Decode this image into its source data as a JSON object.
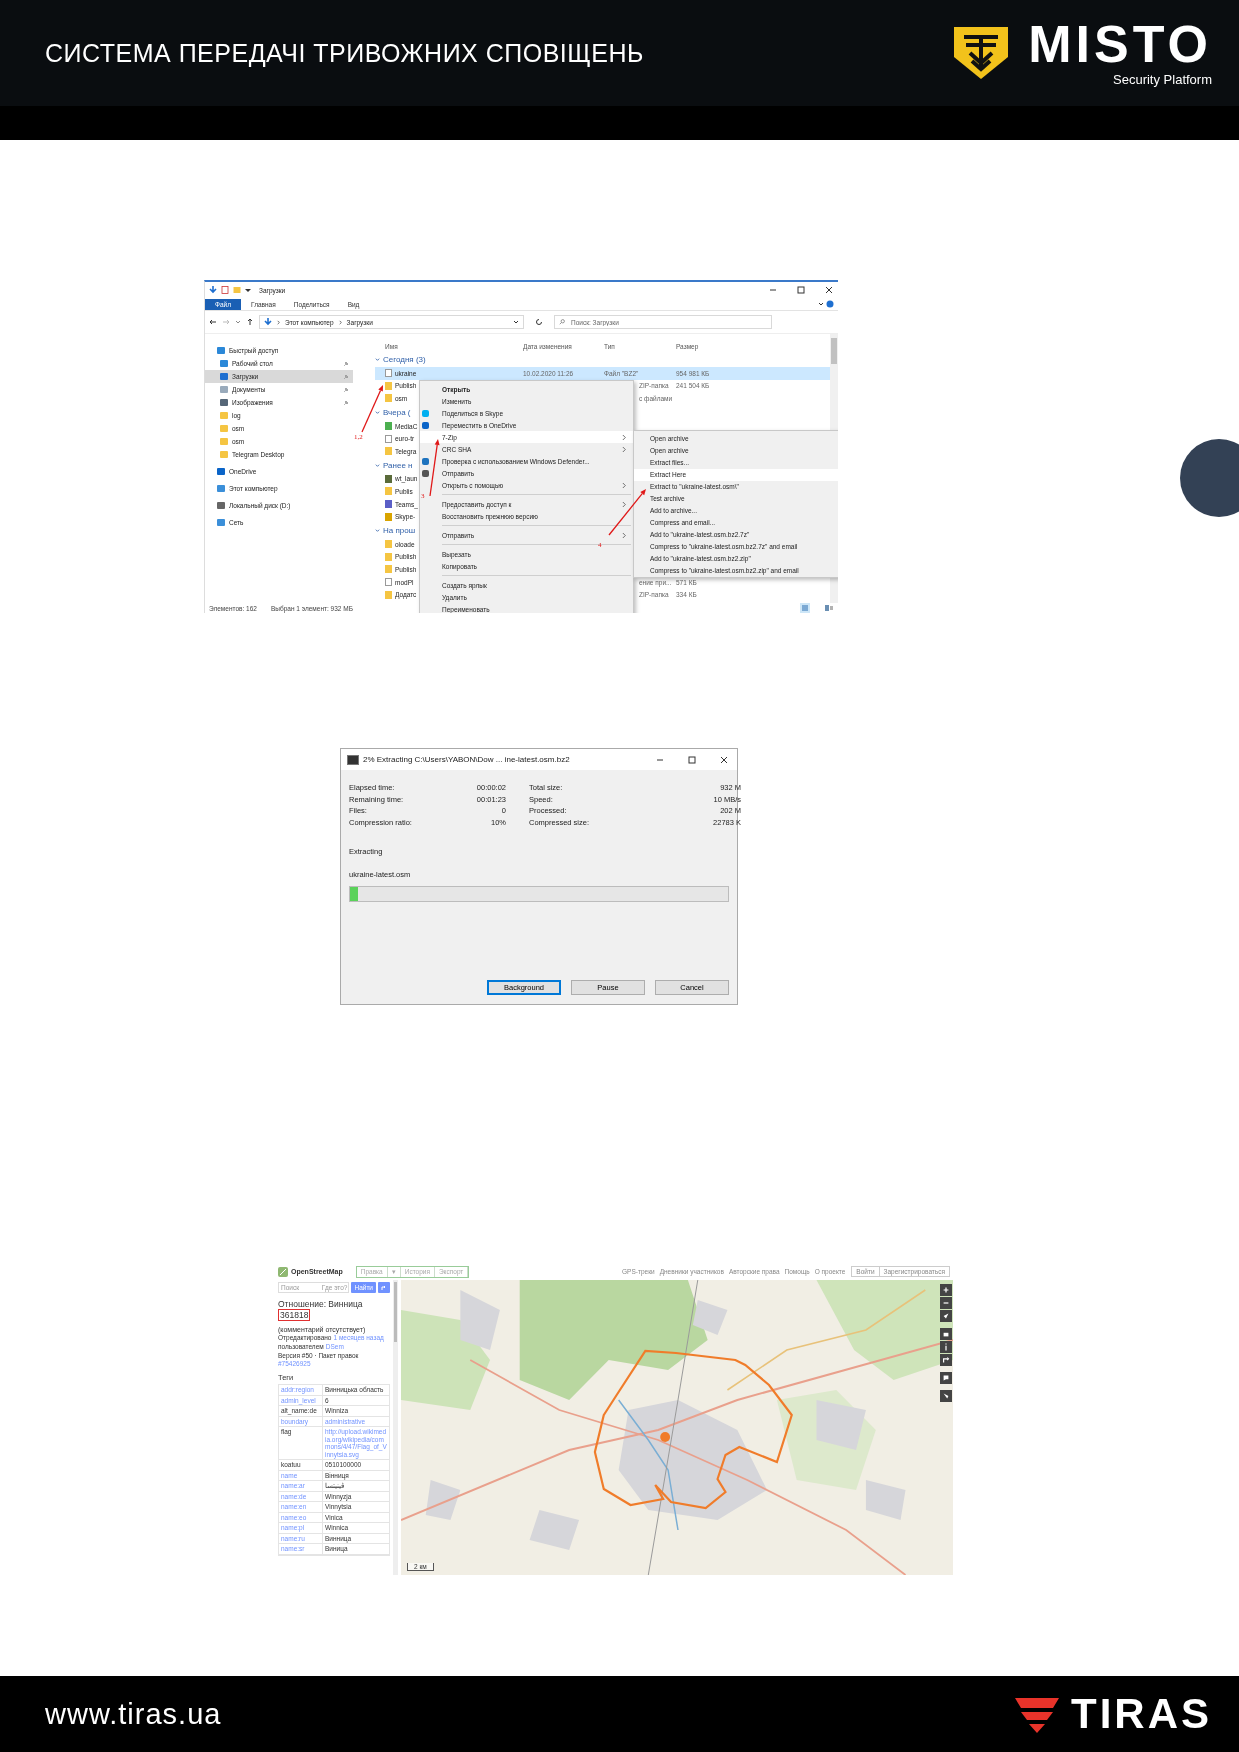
{
  "header": {
    "title": "СИСТЕМА ПЕРЕДАЧІ ТРИВОЖНИХ СПОВІЩЕНЬ",
    "logo": {
      "name": "MISTO",
      "tagline": "Security Platform"
    }
  },
  "explorer": {
    "title": "Загрузки",
    "ribbon_tabs": [
      {
        "label": "Файл",
        "selected": true
      },
      {
        "label": "Главная",
        "selected": false
      },
      {
        "label": "Поделиться",
        "selected": false
      },
      {
        "label": "Вид",
        "selected": false
      }
    ],
    "path": [
      "Этот компьютер",
      "Загрузки"
    ],
    "search": {
      "placeholder": "Поиск: Загрузки"
    },
    "nav": [
      {
        "label": "Быстрый доступ",
        "kind": "star",
        "selected": false,
        "children": [
          {
            "label": "Рабочий стол",
            "kind": "desktop",
            "selected": false,
            "pinned": true
          },
          {
            "label": "Загрузки",
            "kind": "download",
            "selected": true,
            "pinned": true
          },
          {
            "label": "Документы",
            "kind": "document",
            "selected": false,
            "pinned": true
          },
          {
            "label": "Изображения",
            "kind": "pictures",
            "selected": false,
            "pinned": true
          },
          {
            "label": "log",
            "kind": "folder",
            "selected": false,
            "pinned": false
          },
          {
            "label": "osm",
            "kind": "folder",
            "selected": false,
            "pinned": false
          },
          {
            "label": "osm",
            "kind": "folder",
            "selected": false,
            "pinned": false
          },
          {
            "label": "Telegram Desktop",
            "kind": "folder",
            "selected": false,
            "pinned": false
          }
        ]
      },
      {
        "label": "OneDrive",
        "kind": "cloud",
        "selected": false
      },
      {
        "label": "Этот компьютер",
        "kind": "computer",
        "selected": false
      },
      {
        "label": "Локальный диск (D:)",
        "kind": "drive",
        "selected": false
      },
      {
        "label": "Сеть",
        "kind": "network",
        "selected": false
      }
    ],
    "columns": [
      "Имя",
      "Дата изменения",
      "Тип",
      "Размер"
    ],
    "groups": [
      {
        "label": "Сегодня (3)",
        "rows": [
          {
            "name": "ukraine",
            "kind": "file",
            "selected": true,
            "date": "10.02.2020 11:26",
            "type": "Файл \"BZ2\"",
            "size": "954 981 КБ"
          },
          {
            "name": "Publish",
            "kind": "zip",
            "selected": false,
            "type": "ZIP-папка",
            "size": "241 504 КБ"
          },
          {
            "name": "osm",
            "kind": "folder",
            "selected": false,
            "type": "с файлами"
          }
        ]
      },
      {
        "label": "Вчера (",
        "rows": [
          {
            "name": "MediaC",
            "kind": "app",
            "color": "#4caf50",
            "selected": false
          },
          {
            "name": "euro-tr",
            "kind": "file",
            "selected": false
          },
          {
            "name": "Telegra",
            "kind": "folder",
            "selected": false
          }
        ]
      },
      {
        "label": "Ранее н",
        "rows": [
          {
            "name": "wt_laun",
            "kind": "app",
            "color": "#5a6b3a",
            "selected": false
          },
          {
            "name": "Publis",
            "kind": "zip",
            "selected": false
          },
          {
            "name": "Teams_",
            "kind": "app",
            "color": "#5b5fc7",
            "selected": false
          },
          {
            "name": "Skype-",
            "kind": "app",
            "color": "#d9a400",
            "selected": false
          }
        ]
      },
      {
        "label": "На прош",
        "rows": [
          {
            "name": "oloade",
            "kind": "zip",
            "selected": false
          },
          {
            "name": "Publish",
            "kind": "zip",
            "selected": false
          },
          {
            "name": "Publish",
            "kind": "zip",
            "selected": false
          },
          {
            "name": "modPl",
            "kind": "file",
            "selected": false,
            "type": "ение при...",
            "size": "571 КБ"
          },
          {
            "name": "Додатс",
            "kind": "zip",
            "selected": false,
            "type": "ZIP-папка",
            "size": "334 КБ"
          }
        ]
      }
    ],
    "status": [
      "Элементов: 162",
      "Выбран 1 элемент: 932 МБ"
    ],
    "context_menu": {
      "sections": [
        [
          {
            "label": "Открыть",
            "kind": "default",
            "selected": false,
            "submenu": false
          },
          {
            "label": "Изменить",
            "kind": "plain",
            "selected": false,
            "submenu": false
          },
          {
            "label": "Поделиться в Skype",
            "kind": "skype",
            "selected": false,
            "submenu": false
          },
          {
            "label": "Переместить в OneDrive",
            "kind": "onedrive",
            "selected": false,
            "submenu": false
          },
          {
            "label": "7-Zip",
            "kind": "plain",
            "selected": true,
            "submenu": true
          },
          {
            "label": "CRC SHA",
            "kind": "plain",
            "selected": false,
            "submenu": true
          },
          {
            "label": "Проверка с использованием Windows Defender...",
            "kind": "defender",
            "selected": false,
            "submenu": false
          },
          {
            "label": "Отправить",
            "kind": "share",
            "selected": false,
            "submenu": false
          },
          {
            "label": "Открыть с помощью",
            "kind": "plain",
            "selected": false,
            "submenu": true
          }
        ],
        [
          {
            "label": "Предоставить доступ к",
            "kind": "plain",
            "selected": false,
            "submenu": true
          },
          {
            "label": "Восстановить прежнюю версию",
            "kind": "plain",
            "selected": false,
            "submenu": false
          }
        ],
        [
          {
            "label": "Отправить",
            "kind": "plain",
            "selected": false,
            "submenu": true
          }
        ],
        [
          {
            "label": "Вырезать",
            "kind": "plain",
            "selected": false,
            "submenu": false
          },
          {
            "label": "Копировать",
            "kind": "plain",
            "selected": false,
            "submenu": false
          }
        ],
        [
          {
            "label": "Создать ярлык",
            "kind": "plain",
            "selected": false,
            "submenu": false
          },
          {
            "label": "Удалить",
            "kind": "plain",
            "selected": false,
            "submenu": false
          },
          {
            "label": "Переименовать",
            "kind": "plain",
            "selected": false,
            "submenu": false
          }
        ]
      ]
    },
    "submenu": {
      "items": [
        {
          "label": "Open archive",
          "selected": false
        },
        {
          "label": "Open archive",
          "selected": false
        },
        {
          "label": "Extract files...",
          "selected": false
        },
        {
          "label": "Extract Here",
          "selected": true
        },
        {
          "label": "Extract to \"ukraine-latest.osm\\\"",
          "selected": false
        },
        {
          "label": "Test archive",
          "selected": false
        },
        {
          "label": "Add to archive...",
          "selected": false
        },
        {
          "label": "Compress and email...",
          "selected": false
        },
        {
          "label": "Add to \"ukraine-latest.osm.bz2.7z\"",
          "selected": false
        },
        {
          "label": "Compress to \"ukraine-latest.osm.bz2.7z\" and email",
          "selected": false
        },
        {
          "label": "Add to \"ukraine-latest.osm.bz2.zip\"",
          "selected": false
        },
        {
          "label": "Compress to \"ukraine-latest.osm.bz2.zip\" and email",
          "selected": false
        }
      ]
    },
    "annotations": [
      "1,2",
      "3",
      "4"
    ]
  },
  "extract_dialog": {
    "title": "2% Extracting C:\\Users\\YABON\\Dow ... ine-latest.osm.bz2",
    "stats": [
      {
        "label": "Elapsed time:",
        "value": "00:00:02"
      },
      {
        "label": "Remaining time:",
        "value": "00:01:23"
      },
      {
        "label": "Files:",
        "value": "0"
      },
      {
        "label": "Compression ratio:",
        "value": "10%"
      },
      {
        "label": "Total size:",
        "value": "932 M"
      },
      {
        "label": "Speed:",
        "value": "10 MB/s"
      },
      {
        "label": "Processed:",
        "value": "202 M"
      },
      {
        "label": "Compressed size:",
        "value": "22783 K"
      }
    ],
    "status": "Extracting",
    "file": "ukraine-latest.osm",
    "progress": {
      "level": 0.02
    },
    "buttons": [
      {
        "label": "Background",
        "focused": true
      },
      {
        "label": "Pause",
        "focused": false
      },
      {
        "label": "Cancel",
        "focused": false
      }
    ]
  },
  "osm": {
    "logo": "OpenStreetMap",
    "tabs": [
      "Правка",
      "▾",
      "История",
      "Экспорт"
    ],
    "links": [
      "GPS-треки",
      "Дневники участников",
      "Авторские права",
      "Помощь",
      "О проекте"
    ],
    "account_buttons": [
      "Войти",
      "Зарегистрироваться"
    ],
    "search": {
      "placeholder": "Поиск",
      "hint": "Где это?",
      "button": "Найти"
    },
    "heading": "Отношение: Винница",
    "id": "361818",
    "comment": "(комментарий отсутствует)",
    "meta": [
      {
        "text": "Отредактировано",
        "link": "1 месяцев назад"
      },
      {
        "text": "пользователем",
        "link": "DSem"
      },
      {
        "text": "Версия #50 · Пакет правок",
        "link": "#75426925"
      }
    ],
    "tags_title": "Теги",
    "tags": [
      {
        "key": "addr:region",
        "value": "Винницька область",
        "key_linked": true,
        "value_linked": false
      },
      {
        "key": "admin_level",
        "value": "6",
        "key_linked": true,
        "value_linked": false
      },
      {
        "key": "alt_name:de",
        "value": "Winniza",
        "key_linked": false,
        "value_linked": false
      },
      {
        "key": "boundary",
        "value": "administrative",
        "key_linked": true,
        "value_linked": true
      },
      {
        "key": "flag",
        "value": "http://upload.wikimedia.org/wikipedia/commons/4/47/Flag_of_Vinnytsia.svg",
        "key_linked": false,
        "value_linked": true
      },
      {
        "key": "koatuu",
        "value": "0510100000",
        "key_linked": false,
        "value_linked": false
      },
      {
        "key": "name",
        "value": "Вінниця",
        "key_linked": true,
        "value_linked": false
      },
      {
        "key": "name:ar",
        "value": "ڤينيتسا",
        "key_linked": true,
        "value_linked": false
      },
      {
        "key": "name:de",
        "value": "Winnyzja",
        "key_linked": true,
        "value_linked": false
      },
      {
        "key": "name:en",
        "value": "Vinnytsia",
        "key_linked": true,
        "value_linked": false
      },
      {
        "key": "name:eo",
        "value": "Vinica",
        "key_linked": true,
        "value_linked": false
      },
      {
        "key": "name:pl",
        "value": "Winnica",
        "key_linked": true,
        "value_linked": false
      },
      {
        "key": "name:ru",
        "value": "Винница",
        "key_linked": true,
        "value_linked": false
      },
      {
        "key": "name:sr",
        "value": "Виница",
        "key_linked": true,
        "value_linked": false
      }
    ],
    "scale": "2 км"
  },
  "footer": {
    "url": "www.tiras.ua",
    "logo": "TIRAS"
  }
}
